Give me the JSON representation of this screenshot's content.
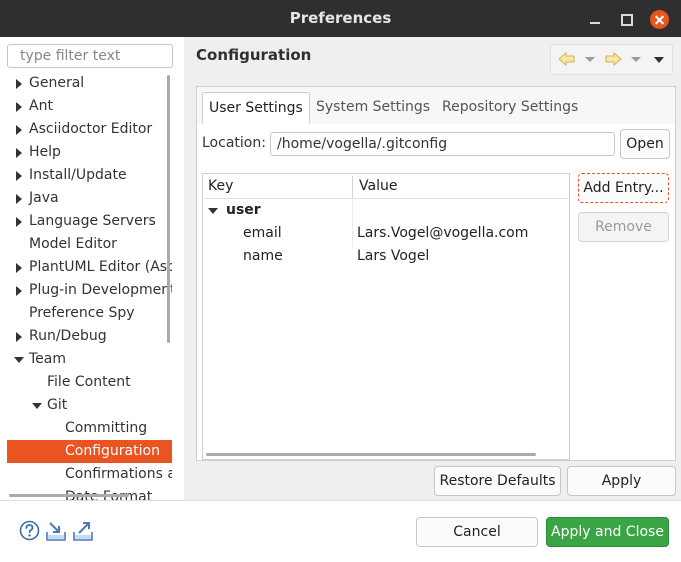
{
  "window": {
    "title": "Preferences"
  },
  "filter": {
    "placeholder": "type filter text"
  },
  "tree": {
    "items": [
      {
        "label": "General"
      },
      {
        "label": "Ant"
      },
      {
        "label": "Asciidoctor Editor"
      },
      {
        "label": "Help"
      },
      {
        "label": "Install/Update"
      },
      {
        "label": "Java"
      },
      {
        "label": "Language Servers"
      },
      {
        "label": "Model Editor"
      },
      {
        "label": "PlantUML Editor (Asciidoctor)"
      },
      {
        "label": "Plug-in Development"
      },
      {
        "label": "Preference Spy"
      },
      {
        "label": "Run/Debug"
      },
      {
        "label": "Team"
      },
      {
        "label": "File Content"
      },
      {
        "label": "Git"
      },
      {
        "label": "Committing"
      },
      {
        "label": "Configuration"
      },
      {
        "label": "Confirmations and Warnings"
      },
      {
        "label": "Date Format"
      }
    ]
  },
  "page": {
    "title": "Configuration"
  },
  "tabs": [
    {
      "label": "User Settings"
    },
    {
      "label": "System Settings"
    },
    {
      "label": "Repository Settings"
    }
  ],
  "location": {
    "label": "Location:",
    "value": "/home/vogella/.gitconfig",
    "open_label": "Open"
  },
  "config_table": {
    "columns": [
      "Key",
      "Value"
    ],
    "group": "user",
    "rows": [
      {
        "key": "email",
        "value": "Lars.Vogel@vogella.com"
      },
      {
        "key": "name",
        "value": "Lars Vogel"
      }
    ]
  },
  "buttons": {
    "add_entry": "Add Entry...",
    "remove": "Remove",
    "restore_defaults": "Restore Defaults",
    "apply": "Apply",
    "cancel": "Cancel",
    "apply_and_close": "Apply and Close"
  },
  "colors": {
    "accent": "#e95420",
    "primary_button": "#3aa545",
    "titlebar": "#2f2f2f"
  }
}
